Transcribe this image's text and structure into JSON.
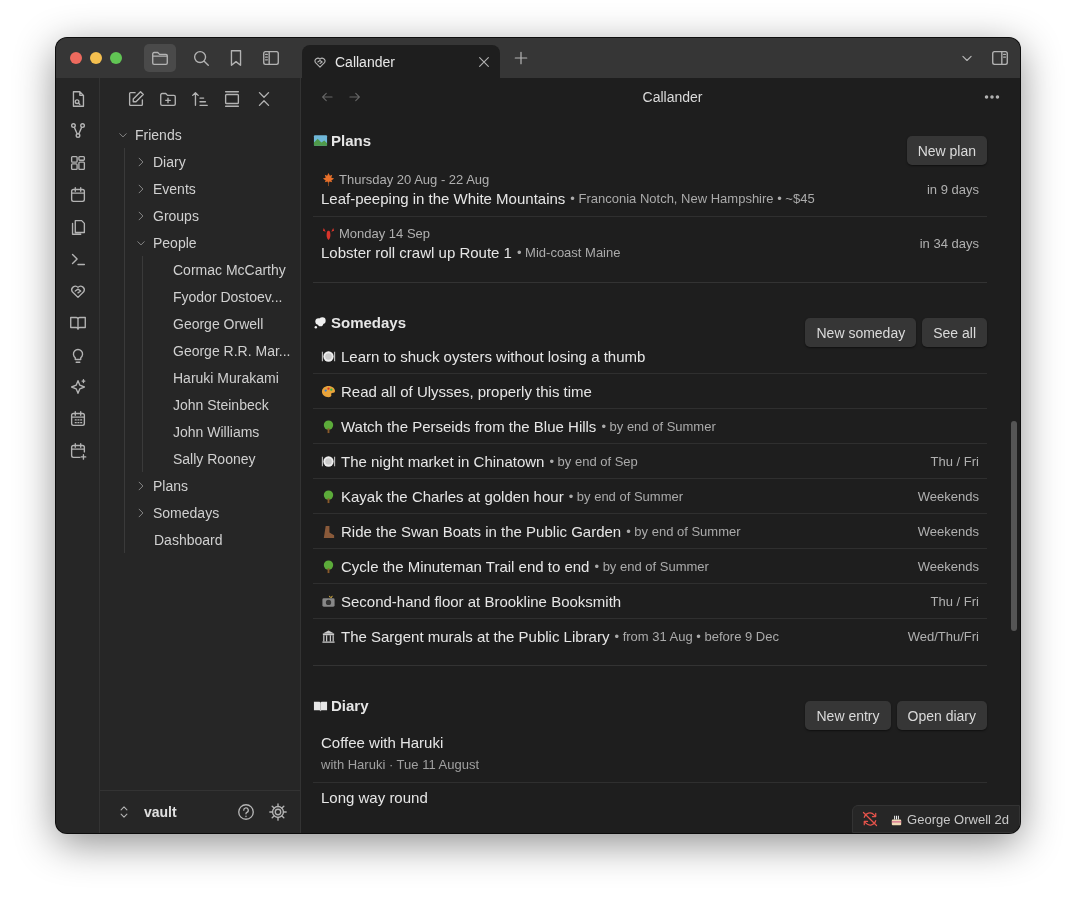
{
  "tabs": [
    {
      "title": "Callander",
      "selected": true
    }
  ],
  "sidebar": {
    "tree": [
      {
        "label": "Friends",
        "kind": "folder",
        "expanded": true,
        "children": [
          {
            "label": "Diary",
            "kind": "folder",
            "expanded": false
          },
          {
            "label": "Events",
            "kind": "folder",
            "expanded": false
          },
          {
            "label": "Groups",
            "kind": "folder",
            "expanded": false
          },
          {
            "label": "People",
            "kind": "folder",
            "expanded": true,
            "children": [
              {
                "label": "Cormac McCarthy",
                "kind": "file"
              },
              {
                "label": "Fyodor Dostoev...",
                "kind": "file"
              },
              {
                "label": "George Orwell",
                "kind": "file"
              },
              {
                "label": "George R.R. Mar...",
                "kind": "file"
              },
              {
                "label": "Haruki Murakami",
                "kind": "file"
              },
              {
                "label": "John Steinbeck",
                "kind": "file"
              },
              {
                "label": "John Williams",
                "kind": "file"
              },
              {
                "label": "Sally Rooney",
                "kind": "file"
              }
            ]
          },
          {
            "label": "Plans",
            "kind": "folder",
            "expanded": false
          },
          {
            "label": "Somedays",
            "kind": "folder",
            "expanded": false
          },
          {
            "label": "Dashboard",
            "kind": "file"
          }
        ]
      }
    ],
    "vault": "vault"
  },
  "view": {
    "title": "Callander"
  },
  "sections": [
    {
      "kind": "plans",
      "heading": "Plans",
      "buttons": [
        "New plan"
      ],
      "items": [
        {
          "kind": "leaf",
          "date": "Thursday 20 Aug - 22 Aug",
          "title": "Leaf-peeping in the White Mountains",
          "details": "• Franconia Notch, New Hampshire • ~$45",
          "when": "in 9 days"
        },
        {
          "kind": "lobster",
          "date": "Monday 14 Sep",
          "title": "Lobster roll crawl up Route 1",
          "details": "• Mid-coast Maine",
          "when": "in 34 days"
        }
      ]
    },
    {
      "kind": "somedays",
      "heading": "Somedays",
      "buttons": [
        "New someday",
        "See all"
      ],
      "items": [
        {
          "kind": "dining",
          "title": "Learn to shuck oysters without losing a thumb"
        },
        {
          "kind": "palette",
          "title": "Read all of Ulysses, properly this time"
        },
        {
          "kind": "tree",
          "title": "Watch the Perseids from the Blue Hills",
          "details": "• by end of Summer"
        },
        {
          "kind": "dining",
          "title": "The night market in Chinatown",
          "details": "• by end of Sep",
          "when": "Thu / Fri"
        },
        {
          "kind": "tree",
          "title": "Kayak the Charles at golden hour",
          "details": "• by end of Summer",
          "when": "Weekends"
        },
        {
          "kind": "boot",
          "title": "Ride the Swan Boats in the Public Garden",
          "details": "• by end of Summer",
          "when": "Weekends"
        },
        {
          "kind": "tree",
          "title": "Cycle the Minuteman Trail end to end",
          "details": "• by end of Summer",
          "when": "Weekends"
        },
        {
          "kind": "camera",
          "title": "Second-hand floor at Brookline Booksmith",
          "when": "Thu / Fri"
        },
        {
          "kind": "building",
          "title": "The Sargent murals at the Public Library",
          "details": "• from 31 Aug • before 9 Dec",
          "when": "Wed/Thu/Fri"
        }
      ]
    },
    {
      "kind": "diary",
      "heading": "Diary",
      "buttons": [
        "New entry",
        "Open diary"
      ],
      "items": [
        {
          "title": "Coffee with Haruki",
          "meta": "with Haruki · Tue 11 August"
        },
        {
          "title": "Long way round"
        }
      ]
    }
  ],
  "status_bar": {
    "sync_error": true,
    "birthday": "George Orwell 2d"
  }
}
